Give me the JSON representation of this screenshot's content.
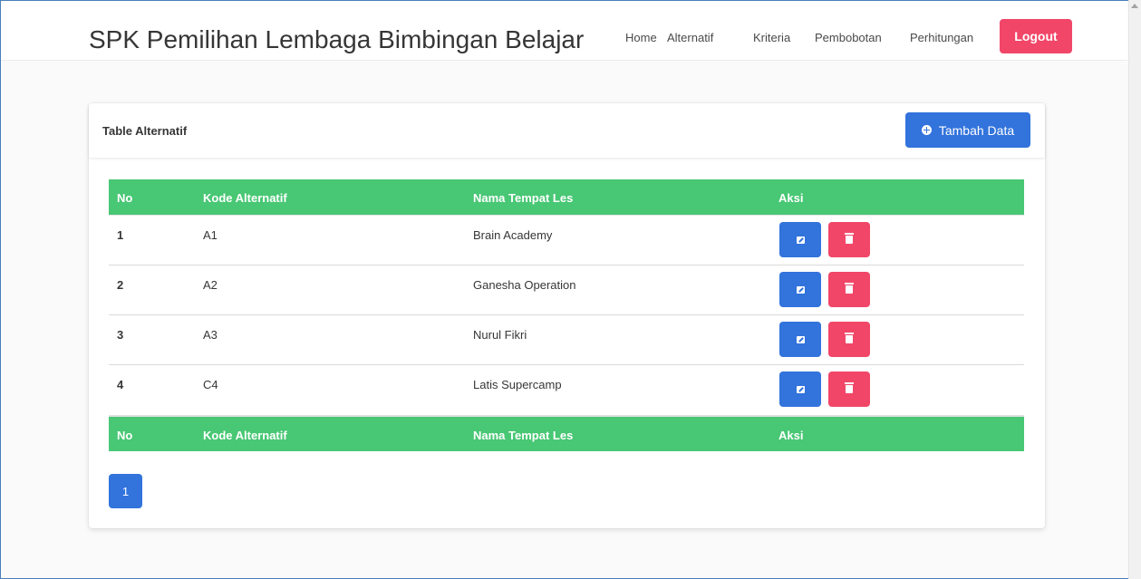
{
  "header": {
    "title": "SPK Pemilihan Lembaga Bimbingan Belajar",
    "nav": [
      {
        "label": "Home"
      },
      {
        "label": "Alternatif"
      },
      {
        "label": "Kriteria"
      },
      {
        "label": "Pembobotan"
      },
      {
        "label": "Perhitungan"
      }
    ],
    "logout_label": "Logout"
  },
  "card": {
    "title": "Table Alternatif",
    "add_label": "Tambah Data"
  },
  "table": {
    "columns": [
      "No",
      "Kode Alternatif",
      "Nama Tempat Les",
      "Aksi"
    ],
    "rows": [
      {
        "no": "1",
        "kode": "A1",
        "nama": "Brain Academy"
      },
      {
        "no": "2",
        "kode": "A2",
        "nama": "Ganesha Operation"
      },
      {
        "no": "3",
        "kode": "A3",
        "nama": "Nurul Fikri"
      },
      {
        "no": "4",
        "kode": "C4",
        "nama": "Latis Supercamp"
      }
    ]
  },
  "pagination": {
    "current": "1"
  },
  "colors": {
    "primary": "#3273dc",
    "danger": "#f14668",
    "success": "#48c774"
  },
  "icons": {
    "add": "plus-circle-icon",
    "edit": "edit-icon",
    "delete": "trash-icon"
  }
}
